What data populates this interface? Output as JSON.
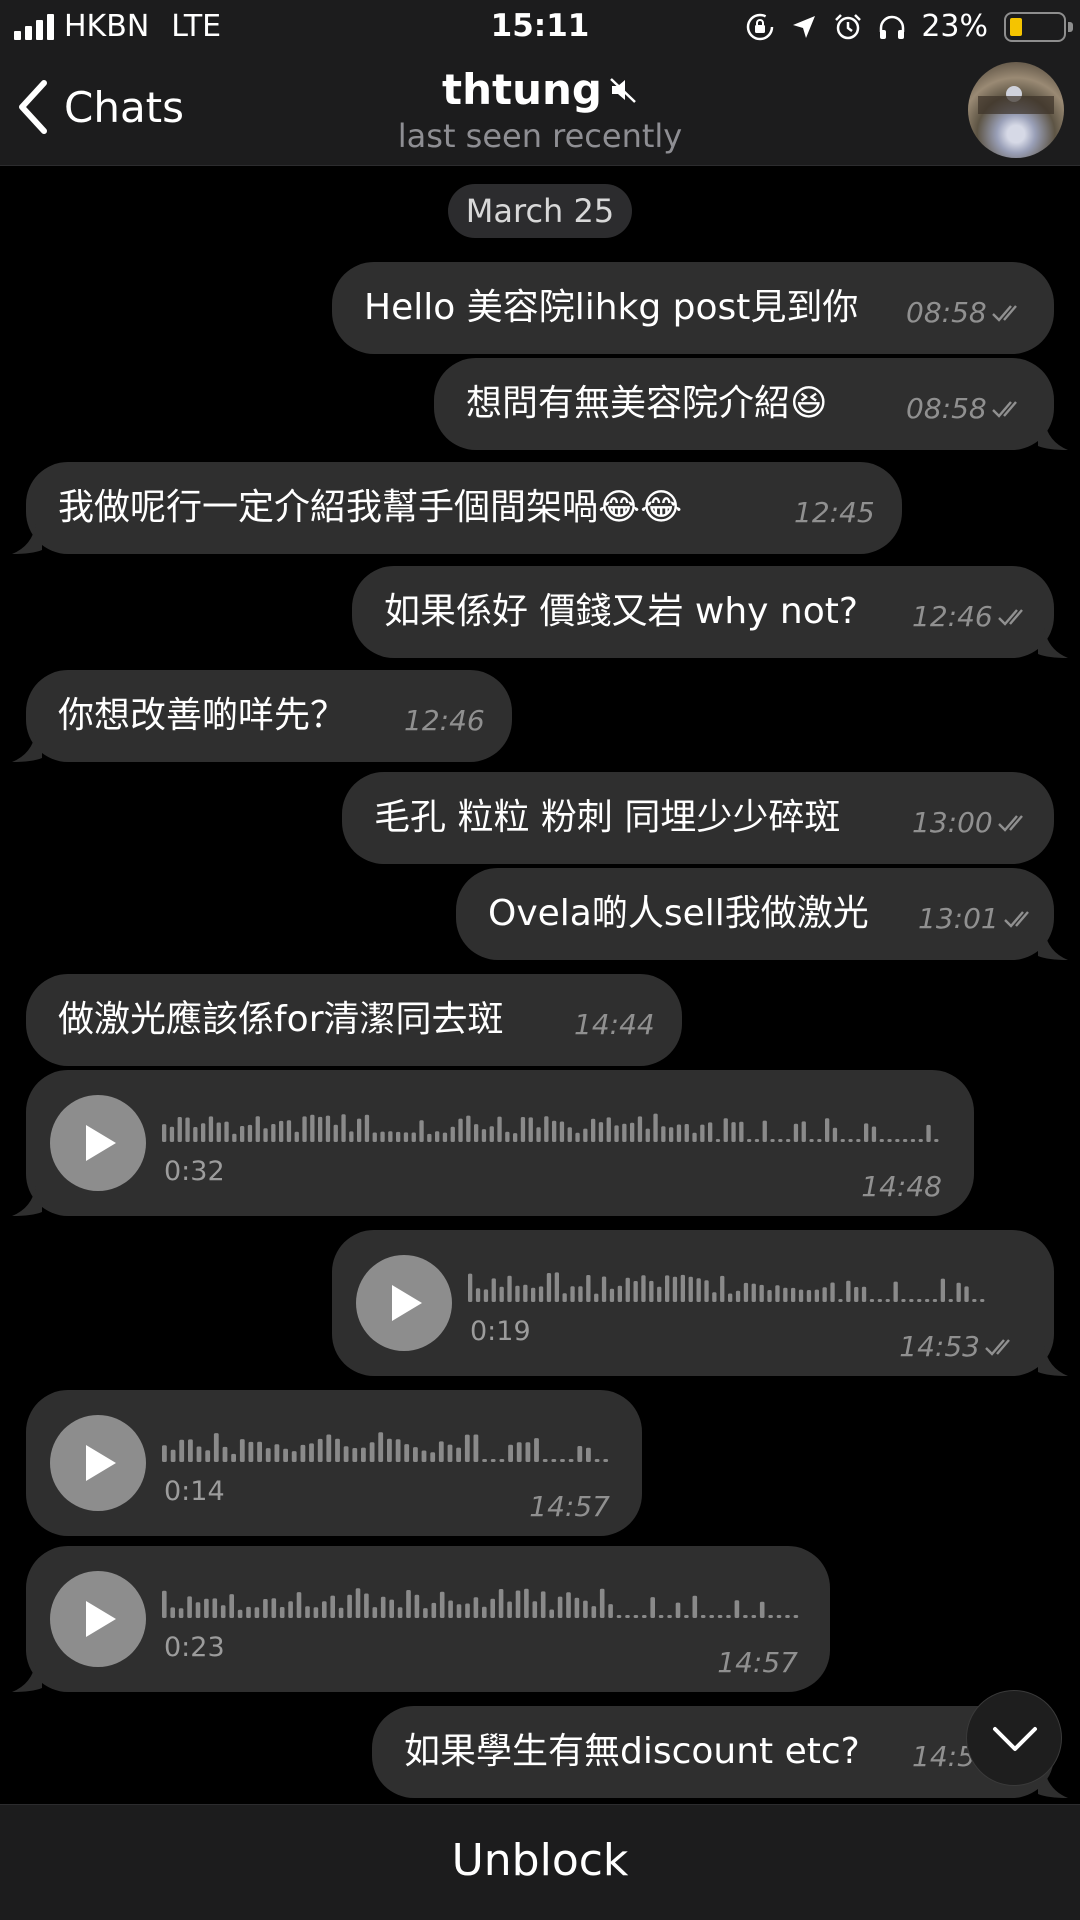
{
  "status_bar": {
    "carrier": "HKBN",
    "network": "LTE",
    "time": "15:11",
    "battery_percent": "23%",
    "battery_level": 0.23,
    "battery_color": "#f5c400",
    "icons": [
      "signal-icon",
      "orientation-lock-icon",
      "location-icon",
      "alarm-icon",
      "headphones-icon",
      "battery-icon"
    ]
  },
  "header": {
    "back_label": "Chats",
    "title": "thtung",
    "subtitle": "last seen recently",
    "muted_icon": "muted-speaker-icon"
  },
  "date_separator": "March 25",
  "messages": [
    {
      "id": "m1",
      "dir": "out",
      "type": "text",
      "text": "Hello 美容院lihkg post見到你",
      "time": "08:58",
      "read": true
    },
    {
      "id": "m2",
      "dir": "out",
      "type": "text",
      "text": "想問有無美容院介紹😆",
      "time": "08:58",
      "read": true
    },
    {
      "id": "m3",
      "dir": "in",
      "type": "text",
      "text": "我做呢行一定介紹我幫手個間架喎😂😂",
      "time": "12:45"
    },
    {
      "id": "m4",
      "dir": "out",
      "type": "text",
      "text": "如果係好 價錢又岩 why not?",
      "time": "12:46",
      "read": true
    },
    {
      "id": "m5",
      "dir": "in",
      "type": "text",
      "text": "你想改善啲咩先？",
      "time": "12:46"
    },
    {
      "id": "m6",
      "dir": "out",
      "type": "text",
      "text": "毛孔 粒粒 粉刺 同埋少少碎斑",
      "time": "13:00",
      "read": true
    },
    {
      "id": "m7",
      "dir": "out",
      "type": "text",
      "text": "Ovela啲人sell我做激光",
      "time": "13:01",
      "read": true
    },
    {
      "id": "m8",
      "dir": "in",
      "type": "text",
      "text": "做激光應該係for清潔同去斑",
      "time": "14:44"
    },
    {
      "id": "v1",
      "dir": "in",
      "type": "voice",
      "duration": "0:32",
      "time": "14:48"
    },
    {
      "id": "v2",
      "dir": "out",
      "type": "voice",
      "duration": "0:19",
      "time": "14:53",
      "read": true
    },
    {
      "id": "v3",
      "dir": "in",
      "type": "voice",
      "duration": "0:14",
      "time": "14:57"
    },
    {
      "id": "v4",
      "dir": "in",
      "type": "voice",
      "duration": "0:23",
      "time": "14:57"
    },
    {
      "id": "m9",
      "dir": "out",
      "type": "text",
      "text": "如果學生有無discount etc?",
      "time": "14:5",
      "read": true
    }
  ],
  "scroll_down_icon": "chevron-down-icon",
  "bottom_bar": {
    "unblock_label": "Unblock"
  },
  "colors": {
    "background": "#000000",
    "bubble": "#2f2f2f",
    "bar": "#1c1c1d",
    "secondary_text": "#8e8e93",
    "play_button": "#8d8d8d"
  }
}
